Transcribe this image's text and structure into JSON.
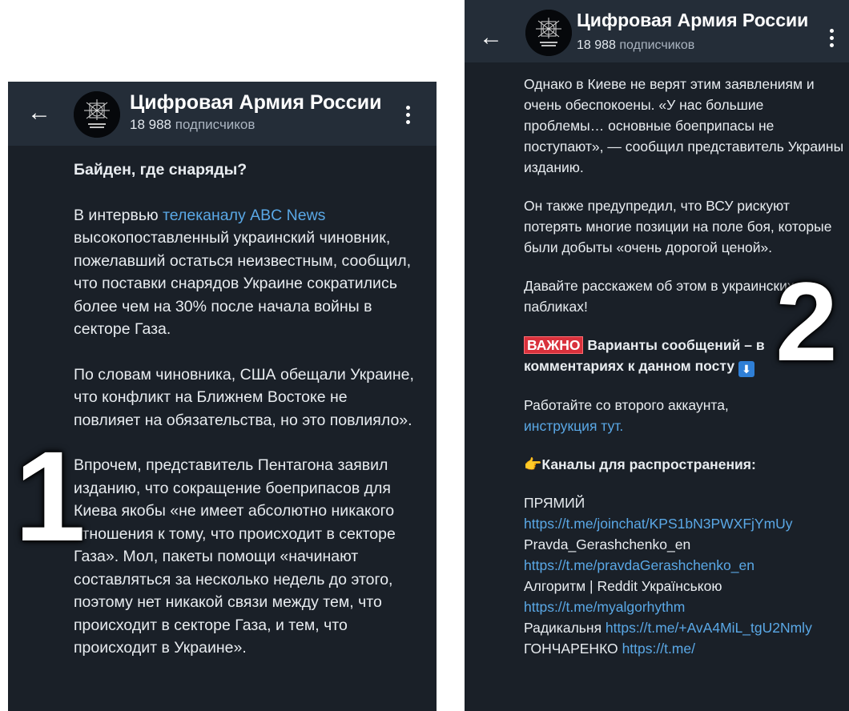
{
  "channel": {
    "name": "Цифровая Армия России",
    "subs_count": "18 988",
    "subs_label": "подписчиков"
  },
  "overlay_numbers": [
    "1",
    "2"
  ],
  "post1": {
    "heading": "Байден, где снаряды?",
    "p1_prefix": "В интервью ",
    "p1_link": "телеканалу ABC News",
    "p1_rest": "высокопоставленный украинский чиновник, пожелавший остаться неизвестным, сообщил, что поставки снарядов Украине сократились более чем на 30% после начала войны в секторе Газа.",
    "p2": "По словам чиновника, США обещали Украине, что конфликт на Ближнем Востоке не повлияет на обязательства, но это повлияло».",
    "p3": "Впрочем, представитель Пентагона заявил изданию, что сокращение боеприпасов для Киева якобы «не имеет абсолютно никакого отношения к тому, что происходит в секторе Газа». Мол, пакеты помощи «начинают составляться за несколько недель до этого, поэтому нет никакой связи между тем, что происходит в секторе Газа, и тем, что происходит в Украине»."
  },
  "post2": {
    "p1": "Однако в Киеве не верят этим заявлениям и очень обеспокоены. «У нас большие проблемы… основные боеприпасы не поступают», — сообщил представитель Украины изданию.",
    "p2": "Он также предупредил, что ВСУ рискуют потерять многие позиции на поле боя, которые были добыты «очень дорогой ценой».",
    "p3": "Давайте расскажем об этом в украинских пабликах!",
    "warn_badge": "ВАЖНО",
    "warn_text": "Варианты сообщений – в комментариях к данном посту",
    "work_text": "Работайте со второго аккаунта,",
    "work_link": "инструкция тут.",
    "channels_heading": "Каналы для распространения:",
    "channels": [
      {
        "name": "ПРЯМИЙ",
        "url": "https://t.me/joinchat/KPS1bN3PWXFjYmUy"
      },
      {
        "name": "Pravda_Gerashchenko_en",
        "url": "https://t.me/pravdaGerashchenko_en"
      },
      {
        "name": "Алгоритм | Reddit Українською",
        "url": "https://t.me/myalgorhythm"
      },
      {
        "name": "Радикальня ",
        "url": "https://t.me/+AvA4MiL_tgU2Nmly"
      },
      {
        "name": "ГОНЧАРЕНКО",
        "url": "https://t.me/"
      }
    ]
  }
}
